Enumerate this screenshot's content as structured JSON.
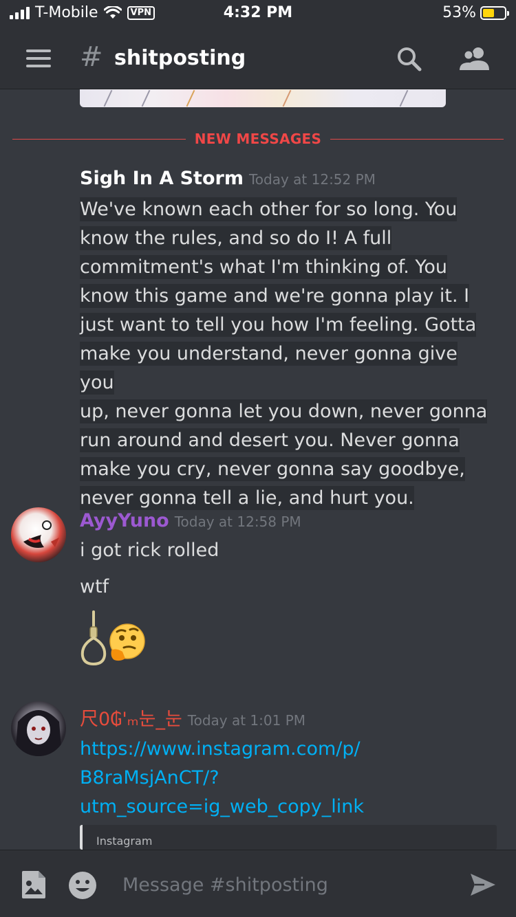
{
  "status_bar": {
    "carrier": "T-Mobile",
    "vpn": "VPN",
    "time": "4:32 PM",
    "battery_percent": "53%",
    "battery_level": 0.53
  },
  "header": {
    "hash": "#",
    "channel_name": "shitposting"
  },
  "divider": {
    "label": "NEW MESSAGES"
  },
  "messages": [
    {
      "author": "Sigh In A Storm",
      "timestamp": "Today at 12:52 PM",
      "lines": [
        "We've known each other for so long.  You",
        "know the rules, and so do I!  A full",
        "commitment's what I'm thinking of.  You",
        "know this game and we're gonna play it.  I",
        "just want to tell you how I'm feeling.  Gotta",
        "make you understand, never gonna give you",
        "up, never gonna let you down, never gonna",
        "run around and desert you.  Never gonna",
        "make you cry, never gonna say goodbye,",
        "never gonna tell a lie, and hurt you."
      ]
    },
    {
      "author": "AyyYuno",
      "author_color": "#9c59d1",
      "timestamp": "Today at 12:58 PM",
      "line1": "i got rick rolled",
      "line2": "wtf",
      "emojis": [
        "noose-emoji",
        "thinking-face-emoji"
      ]
    },
    {
      "author": "尺0₲'ₘ눈_눈",
      "author_color": "#e74c3c",
      "timestamp": "Today at 1:01 PM",
      "link_lines": [
        "https://www.instagram.com/p/",
        "B8raMsjAnCT/?",
        "utm_source=ig_web_copy_link"
      ],
      "embed_provider": "Instagram"
    }
  ],
  "composer": {
    "placeholder": "Message #shitposting"
  }
}
